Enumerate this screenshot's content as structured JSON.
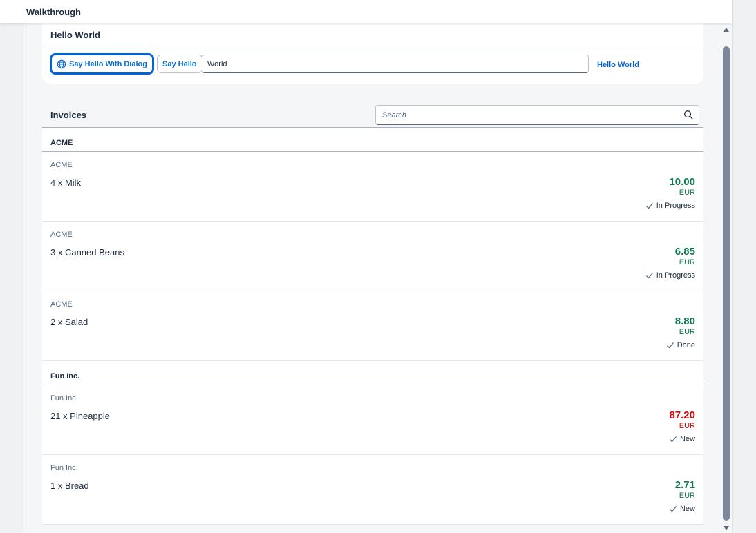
{
  "app": {
    "title": "Walkthrough"
  },
  "hello_panel": {
    "title": "Hello World",
    "dialog_button_label": "Say Hello With Dialog",
    "hello_button_label": "Say Hello",
    "name_input_value": "World",
    "greeting_text": "Hello World"
  },
  "invoices": {
    "title": "Invoices",
    "search_placeholder": "Search",
    "groups": [
      {
        "name": "ACME",
        "items": [
          {
            "vendor": "ACME",
            "description": "4 x Milk",
            "amount": "10.00",
            "currency": "EUR",
            "status": "In Progress",
            "state": "good"
          },
          {
            "vendor": "ACME",
            "description": "3 x Canned Beans",
            "amount": "6.85",
            "currency": "EUR",
            "status": "In Progress",
            "state": "good"
          },
          {
            "vendor": "ACME",
            "description": "2 x Salad",
            "amount": "8.80",
            "currency": "EUR",
            "status": "Done",
            "state": "good"
          }
        ]
      },
      {
        "name": "Fun Inc.",
        "items": [
          {
            "vendor": "Fun Inc.",
            "description": "21 x Pineapple",
            "amount": "87.20",
            "currency": "EUR",
            "status": "New",
            "state": "bad"
          },
          {
            "vendor": "Fun Inc.",
            "description": "1 x Bread",
            "amount": "2.71",
            "currency": "EUR",
            "status": "New",
            "state": "good"
          }
        ]
      }
    ]
  },
  "colors": {
    "accent": "#0064d9",
    "positive": "#0f7a4e",
    "negative": "#d20a0a"
  },
  "icons": {
    "dialog_button": "globe-icon",
    "search": "search-icon",
    "status": "checkmark-icon"
  }
}
